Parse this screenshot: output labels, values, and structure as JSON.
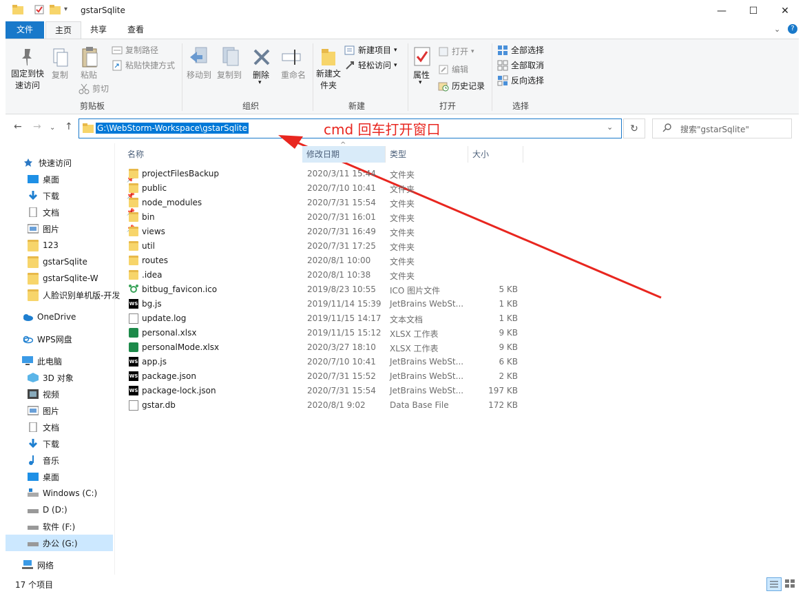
{
  "window": {
    "title": "gstarSqlite",
    "controls": [
      "—",
      "☐",
      "✕"
    ]
  },
  "ribbon": {
    "tabs": [
      "文件",
      "主页",
      "共享",
      "查看"
    ],
    "clipboard": {
      "pin_label": "固定到快速访问",
      "copy_label": "复制",
      "paste_label": "粘贴",
      "copy_path": "复制路径",
      "paste_shortcut": "粘贴快捷方式",
      "cut": "剪切",
      "group": "剪贴板"
    },
    "organize": {
      "move_to": "移动到",
      "copy_to": "复制到",
      "delete": "删除",
      "rename": "重命名",
      "group": "组织"
    },
    "new": {
      "new_folder": "新建文件夹",
      "new_item": "新建项目",
      "easy_access": "轻松访问",
      "group": "新建"
    },
    "open": {
      "properties": "属性",
      "open": "打开",
      "edit": "编辑",
      "history": "历史记录",
      "group": "打开"
    },
    "select": {
      "select_all": "全部选择",
      "select_none": "全部取消",
      "invert": "反向选择",
      "group": "选择"
    }
  },
  "address": {
    "path": "G:\\WebStorm-Workspace\\gstarSqlite",
    "search_placeholder": "搜索\"gstarSqlite\""
  },
  "annotation": {
    "text": "cmd 回车打开窗口",
    "color": "#e8261f"
  },
  "nav": {
    "quick_access": "快速访问",
    "quick_items": [
      "桌面",
      "下载",
      "文档",
      "图片",
      "123",
      "gstarSqlite",
      "gstarSqlite-W",
      "人脸识别单机版-开发"
    ],
    "onedrive": "OneDrive",
    "wps": "WPS网盘",
    "this_pc": "此电脑",
    "pc_items": [
      "3D 对象",
      "视频",
      "图片",
      "文档",
      "下载",
      "音乐",
      "桌面",
      "Windows (C:)",
      "D (D:)",
      "软件 (F:)",
      "办公 (G:)"
    ],
    "network": "网络"
  },
  "columns": {
    "name": "名称",
    "date": "修改日期",
    "type": "类型",
    "size": "大小"
  },
  "files": [
    {
      "name": "projectFilesBackup",
      "date": "2020/3/11 15:44",
      "type": "文件夹",
      "size": "",
      "icon": "folder"
    },
    {
      "name": "public",
      "date": "2020/7/10 10:41",
      "type": "文件夹",
      "size": "",
      "icon": "folder"
    },
    {
      "name": "node_modules",
      "date": "2020/7/31 15:54",
      "type": "文件夹",
      "size": "",
      "icon": "folder"
    },
    {
      "name": "bin",
      "date": "2020/7/31 16:01",
      "type": "文件夹",
      "size": "",
      "icon": "folder"
    },
    {
      "name": "views",
      "date": "2020/7/31 16:49",
      "type": "文件夹",
      "size": "",
      "icon": "folder"
    },
    {
      "name": "util",
      "date": "2020/7/31 17:25",
      "type": "文件夹",
      "size": "",
      "icon": "folder"
    },
    {
      "name": "routes",
      "date": "2020/8/1 10:00",
      "type": "文件夹",
      "size": "",
      "icon": "folder"
    },
    {
      "name": ".idea",
      "date": "2020/8/1 10:38",
      "type": "文件夹",
      "size": "",
      "icon": "folder"
    },
    {
      "name": "bitbug_favicon.ico",
      "date": "2019/8/23 10:55",
      "type": "ICO 图片文件",
      "size": "5 KB",
      "icon": "ico"
    },
    {
      "name": "bg.js",
      "date": "2019/11/14 15:39",
      "type": "JetBrains WebSt...",
      "size": "1 KB",
      "icon": "ws"
    },
    {
      "name": "update.log",
      "date": "2019/11/15 14:17",
      "type": "文本文档",
      "size": "1 KB",
      "icon": "doc"
    },
    {
      "name": "personal.xlsx",
      "date": "2019/11/15 15:12",
      "type": "XLSX 工作表",
      "size": "9 KB",
      "icon": "xls"
    },
    {
      "name": "personalMode.xlsx",
      "date": "2020/3/27 18:10",
      "type": "XLSX 工作表",
      "size": "9 KB",
      "icon": "xls"
    },
    {
      "name": "app.js",
      "date": "2020/7/10 10:41",
      "type": "JetBrains WebSt...",
      "size": "6 KB",
      "icon": "ws"
    },
    {
      "name": "package.json",
      "date": "2020/7/31 15:52",
      "type": "JetBrains WebSt...",
      "size": "2 KB",
      "icon": "ws"
    },
    {
      "name": "package-lock.json",
      "date": "2020/7/31 15:54",
      "type": "JetBrains WebSt...",
      "size": "197 KB",
      "icon": "ws"
    },
    {
      "name": "gstar.db",
      "date": "2020/8/1 9:02",
      "type": "Data Base File",
      "size": "172 KB",
      "icon": "doc"
    }
  ],
  "status": {
    "count": "17 个项目"
  }
}
